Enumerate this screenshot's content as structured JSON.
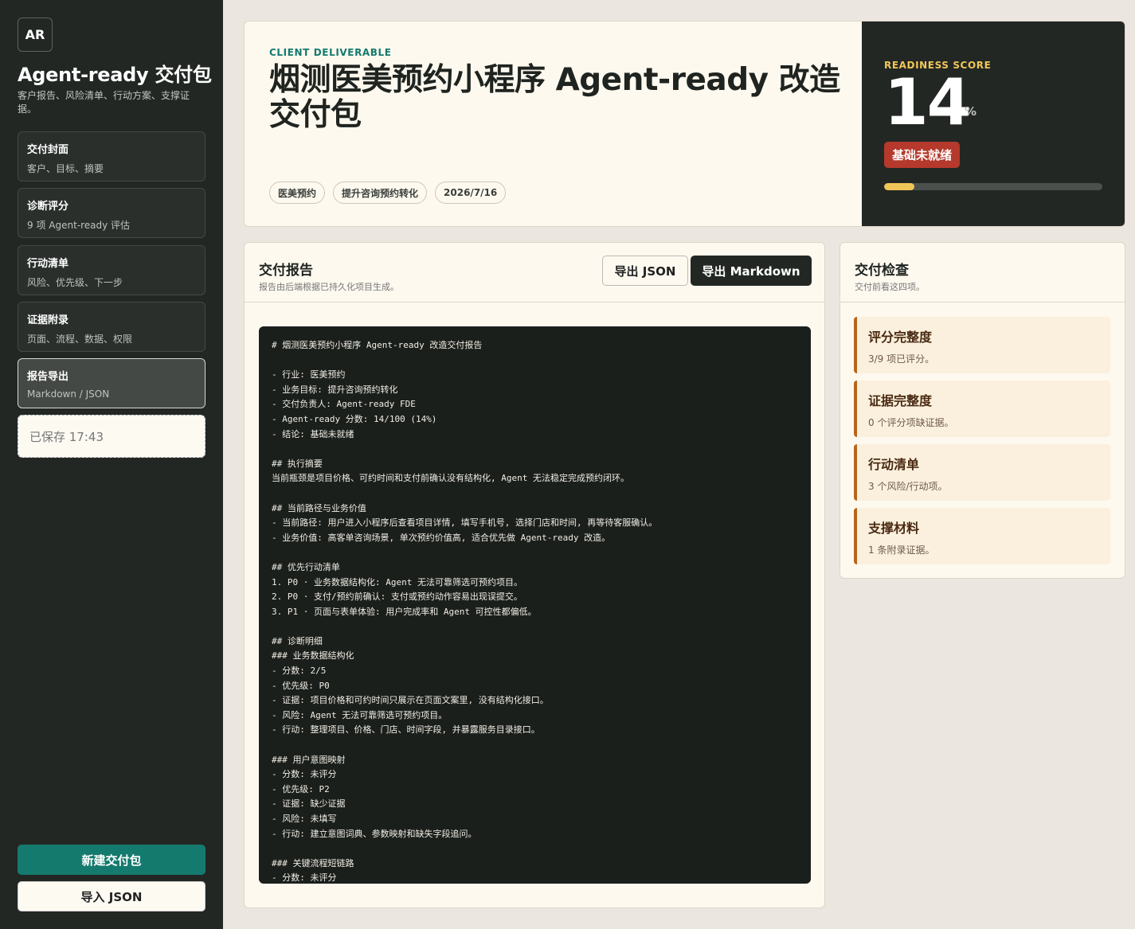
{
  "sidebar": {
    "logo": "AR",
    "title": "Agent-ready 交付包",
    "subtitle": "客户报告、风险清单、行动方案、支撑证据。",
    "nav": [
      {
        "title": "交付封面",
        "desc": "客户、目标、摘要"
      },
      {
        "title": "诊断评分",
        "desc": "9 项 Agent-ready 评估"
      },
      {
        "title": "行动清单",
        "desc": "风险、优先级、下一步"
      },
      {
        "title": "证据附录",
        "desc": "页面、流程、数据、权限"
      },
      {
        "title": "报告导出",
        "desc": "Markdown / JSON"
      }
    ],
    "saved": "已保存 17:43",
    "new_button": "新建交付包",
    "import_button": "导入 JSON"
  },
  "hero": {
    "eyebrow": "CLIENT DELIVERABLE",
    "title": "烟测医美预约小程序 Agent-ready 改造交付包",
    "chips": [
      "医美预约",
      "提升咨询预约转化",
      "2026/7/16"
    ],
    "score_label": "READINESS SCORE",
    "score": "14",
    "score_unit": "%",
    "score_fraction": 0.14,
    "status": "基础未就绪"
  },
  "report": {
    "title": "交付报告",
    "subtitle": "报告由后端根据已持久化项目生成。",
    "export_json": "导出 JSON",
    "export_md": "导出 Markdown",
    "content": "# 烟测医美预约小程序 Agent-ready 改造交付报告\n\n- 行业: 医美预约\n- 业务目标: 提升咨询预约转化\n- 交付负责人: Agent-ready FDE\n- Agent-ready 分数: 14/100 (14%)\n- 结论: 基础未就绪\n\n## 执行摘要\n当前瓶颈是项目价格、可约时间和支付前确认没有结构化, Agent 无法稳定完成预约闭环。\n\n## 当前路径与业务价值\n- 当前路径: 用户进入小程序后查看项目详情, 填写手机号, 选择门店和时间, 再等待客服确认。\n- 业务价值: 高客单咨询场景, 单次预约价值高, 适合优先做 Agent-ready 改造。\n\n## 优先行动清单\n1. P0 · 业务数据结构化: Agent 无法可靠筛选可预约项目。\n2. P0 · 支付/预约前确认: 支付或预约动作容易出现误提交。\n3. P1 · 页面与表单体验: 用户完成率和 Agent 可控性都偏低。\n\n## 诊断明细\n### 业务数据结构化\n- 分数: 2/5\n- 优先级: P0\n- 证据: 项目价格和可约时间只展示在页面文案里, 没有结构化接口。\n- 风险: Agent 无法可靠筛选可预约项目。\n- 行动: 整理项目、价格、门店、时间字段, 并暴露服务目录接口。\n\n### 用户意图映射\n- 分数: 未评分\n- 优先级: P2\n- 证据: 缺少证据\n- 风险: 未填写\n- 行动: 建立意图词典、参数映射和缺失字段追问。\n\n### 关键流程短链路\n- 分数: 未评分"
  },
  "checks": {
    "title": "交付检查",
    "subtitle": "交付前看这四项。",
    "items": [
      {
        "title": "评分完整度",
        "desc": "3/9 项已评分。"
      },
      {
        "title": "证据完整度",
        "desc": "0 个评分项缺证据。"
      },
      {
        "title": "行动清单",
        "desc": "3 个风险/行动项。"
      },
      {
        "title": "支撑材料",
        "desc": "1 条附录证据。"
      }
    ]
  }
}
